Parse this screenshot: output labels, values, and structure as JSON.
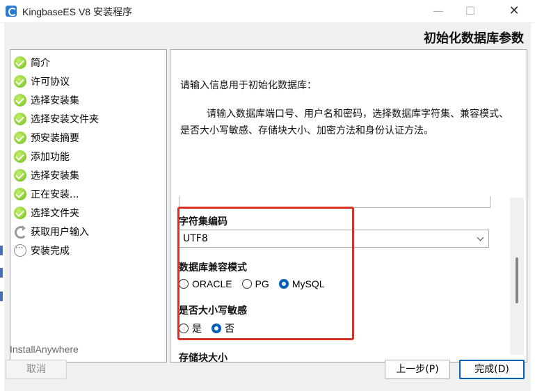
{
  "window": {
    "title": "KingbaseES V8 安装程序",
    "minimize_glyph": "—",
    "maximize_glyph": "☐",
    "close_glyph": "✕"
  },
  "page_title": "初始化数据库参数",
  "steps": [
    {
      "label": "简介",
      "status": "done"
    },
    {
      "label": "许可协议",
      "status": "done"
    },
    {
      "label": "选择安装集",
      "status": "done"
    },
    {
      "label": "选择安装文件夹",
      "status": "done"
    },
    {
      "label": "预安装摘要",
      "status": "done"
    },
    {
      "label": "添加功能",
      "status": "done"
    },
    {
      "label": "选择安装集",
      "status": "done"
    },
    {
      "label": "正在安装...",
      "status": "done"
    },
    {
      "label": "选择文件夹",
      "status": "done"
    },
    {
      "label": "获取用户输入",
      "status": "current"
    },
    {
      "label": "安装完成",
      "status": "pending"
    }
  ],
  "content": {
    "intro": "请输入信息用于初始化数据库：",
    "description": "请输入数据库端口号、用户名和密码，选择数据库字符集、兼容模式、是否大小写敏感、存储块大小、加密方法和身份认证方法。",
    "charset": {
      "label": "字符集编码",
      "value": "UTF8"
    },
    "compat_mode": {
      "label": "数据库兼容模式",
      "options": [
        "ORACLE",
        "PG",
        "MySQL"
      ],
      "selected": "MySQL"
    },
    "case_sensitive": {
      "label": "是否大小写敏感",
      "options": [
        "是",
        "否"
      ],
      "selected": "否"
    },
    "next_label_partial": "存储块大小"
  },
  "footer": {
    "vendor": "InstallAnywhere",
    "cancel": "取消",
    "previous": "上一步(P)",
    "done": "完成(D)"
  },
  "colors": {
    "highlight": "#d93025",
    "radio_selected": "#005fb8",
    "step_done": "#6cbd1a"
  }
}
